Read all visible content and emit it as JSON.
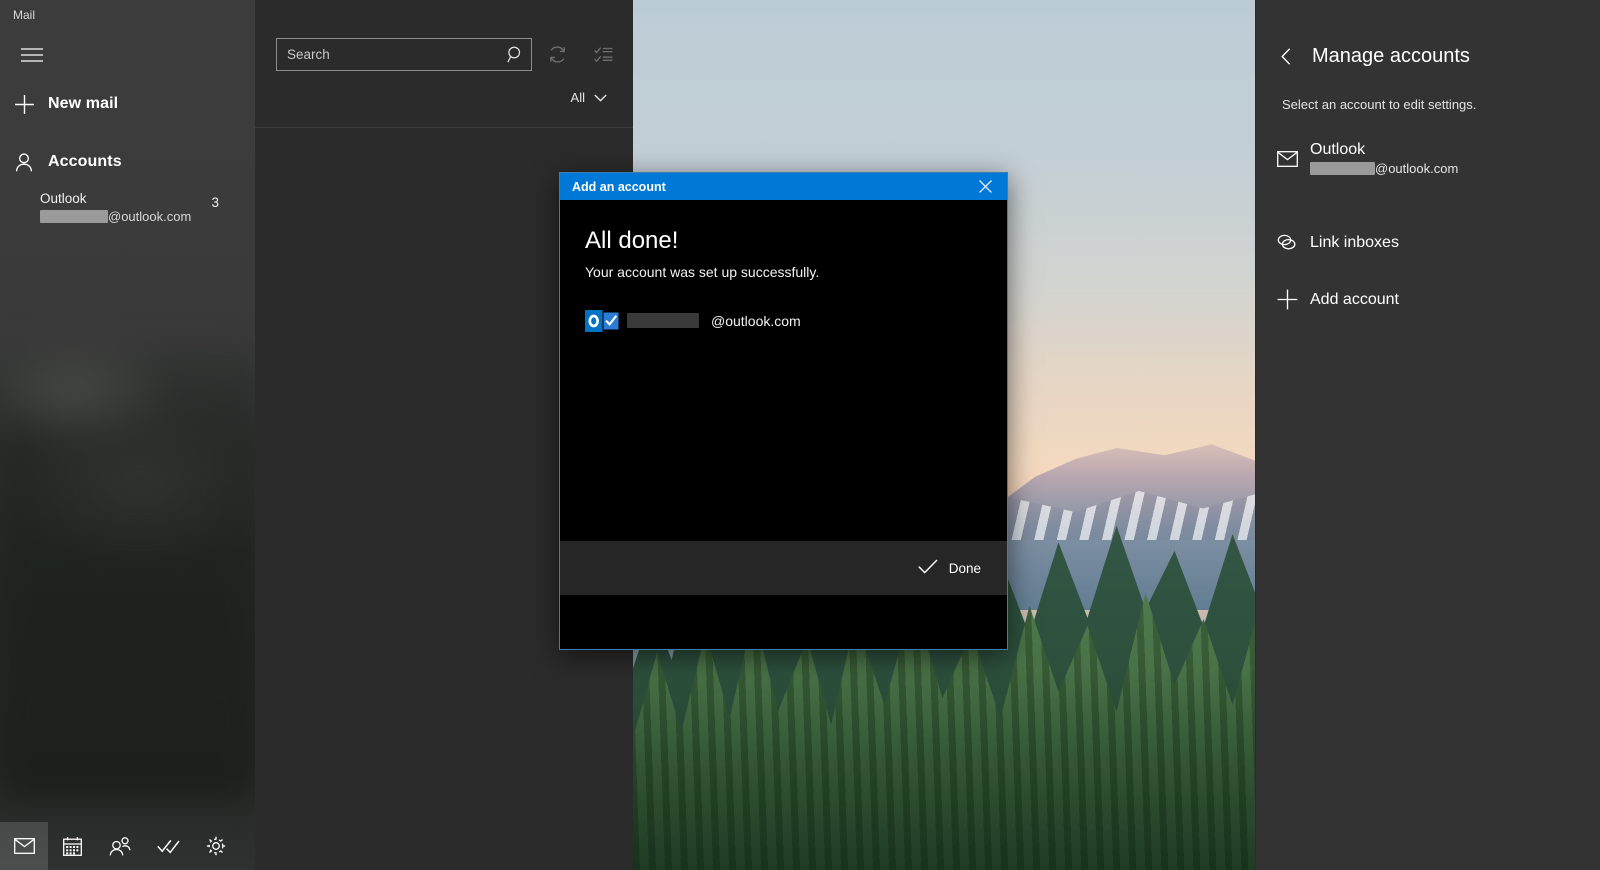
{
  "window": {
    "app_title": "Mail",
    "controls": [
      {
        "name": "minimize-button",
        "glyph": "minimize"
      },
      {
        "name": "maximize-button",
        "glyph": "maximize"
      },
      {
        "name": "close-button",
        "glyph": "close"
      }
    ]
  },
  "left_nav": {
    "hamburger_icon": "hamburger-icon",
    "new_mail": {
      "label": "New mail",
      "icon": "plus-icon"
    },
    "accounts": {
      "label": "Accounts",
      "icon": "person-icon"
    },
    "account_item": {
      "name": "Outlook",
      "unread_count": "3",
      "email_domain": "@outlook.com",
      "email_user_redacted": true
    },
    "bottom_nav": [
      {
        "name": "mail-nav-icon",
        "icon": "mail-icon",
        "selected": true
      },
      {
        "name": "calendar-nav-icon",
        "icon": "calendar-icon",
        "selected": false
      },
      {
        "name": "people-nav-icon",
        "icon": "people-icon",
        "selected": false
      },
      {
        "name": "todo-nav-icon",
        "icon": "check-icon",
        "selected": false
      },
      {
        "name": "settings-nav-icon",
        "icon": "gear-icon",
        "selected": false
      }
    ]
  },
  "message_list": {
    "search": {
      "placeholder": "Search",
      "value": "",
      "icon": "search-icon"
    },
    "sync_button_icon": "sync-icon",
    "select_button_icon": "selection-mode-icon",
    "filter": {
      "label": "All",
      "icon": "chevron-down-icon"
    }
  },
  "settings_pane": {
    "back_icon": "chevron-left-icon",
    "title": "Manage accounts",
    "subtitle": "Select an account to edit settings.",
    "rows": [
      {
        "name": "settings-account-outlook",
        "icon": "envelope-icon",
        "title": "Outlook",
        "subtitle": "@outlook.com",
        "redacted": true
      },
      {
        "name": "settings-link-inboxes",
        "icon": "link-icon",
        "title": "Link inboxes",
        "subtitle": "",
        "redacted": false
      },
      {
        "name": "settings-add-account",
        "icon": "plus-icon",
        "title": "Add account",
        "subtitle": "",
        "redacted": false
      }
    ]
  },
  "dialog": {
    "title": "Add an account",
    "close_icon": "close-icon",
    "heading": "All done!",
    "message": "Your account was set up successfully.",
    "account": {
      "icon": "outlook-logo-icon",
      "email_domain": "@outlook.com",
      "email_user_redacted": true
    },
    "done_button": {
      "label": "Done",
      "icon": "checkmark-icon"
    }
  },
  "colors": {
    "accent_blue": "#0078d7",
    "dialog_border": "#3e7cb1",
    "left_nav_bg": "#3c3c3c",
    "list_pane_bg": "#2b2b2b",
    "settings_pane_bg": "#333333",
    "dialog_body_bg": "#000000",
    "dialog_footer_bg": "#262626"
  }
}
